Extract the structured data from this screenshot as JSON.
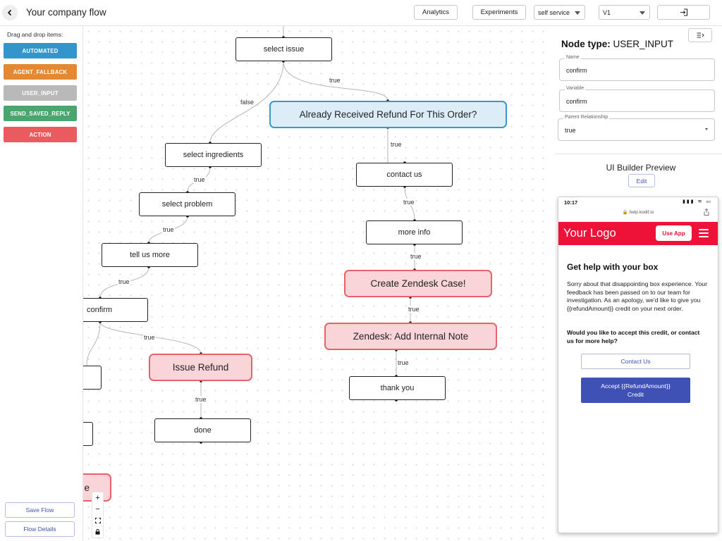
{
  "header": {
    "title": "Your company flow",
    "analytics_label": "Analytics",
    "experiments_label": "Experiments",
    "service_select": "self service",
    "version_select": "V1"
  },
  "sidebar": {
    "drag_label": "Drag and drop items:",
    "items": [
      {
        "label": "AUTOMATED",
        "color": "#3395cc"
      },
      {
        "label": "AGENT_FALLBACK",
        "color": "#e48832"
      },
      {
        "label": "USER_INPUT",
        "color": "#b9b9b9"
      },
      {
        "label": "SEND_SAVED_REPLY",
        "color": "#4aa56e"
      },
      {
        "label": "ACTION",
        "color": "#e95b5f"
      }
    ],
    "save_label": "Save Flow",
    "details_label": "Flow Details"
  },
  "canvas": {
    "nodes": {
      "select_issue": "select issue",
      "already_received": "Already Received Refund For This Order?",
      "select_ingredients": "select ingredients",
      "contact_us": "contact us",
      "select_problem": "select problem",
      "more_info": "more info",
      "tell_us_more": "tell us more",
      "create_zendesk": "Create Zendesk Case!",
      "confirm": "confirm",
      "zendesk_note": "Zendesk: Add Internal Note",
      "issue_refund": "Issue Refund",
      "thank_you": "thank you",
      "done": "done",
      "partial_red": "e"
    },
    "edge_labels": {
      "true": "true",
      "false": "false"
    },
    "zoom": {
      "in": "+",
      "out": "−",
      "fit": "⛶",
      "lock": "🔒"
    }
  },
  "panel": {
    "node_type_label": "Node type:",
    "node_type_value": "USER_INPUT",
    "name_label": "Name",
    "name_value": "confirm",
    "variable_label": "Variable",
    "variable_value": "confirm",
    "parent_label": "Parent Relationship",
    "parent_value": "true",
    "preview_title": "UI Builder Preview",
    "edit_label": "Edit"
  },
  "phone": {
    "time": "10:17",
    "status_icons": "▮▮▮ ≋ ▭",
    "url": "🔒 help.kodif.io",
    "logo": "Your Logo",
    "use_app": "Use App",
    "heading": "Get help with your box",
    "body": "Sorry about that disappointing box experience. Your feedback has been passed on to our team for investigation. As an apology, we'd like to give you {{refundAmount}} credit on your next order.",
    "question": "Would you like to accept this credit, or contact us for more help?",
    "contact_btn": "Contact Us",
    "accept_btn_line1": "Accept {{RefundAmount}}",
    "accept_btn_line2": "Credit",
    "brand_color": "#ee1238",
    "button_color": "#3f51b5"
  }
}
